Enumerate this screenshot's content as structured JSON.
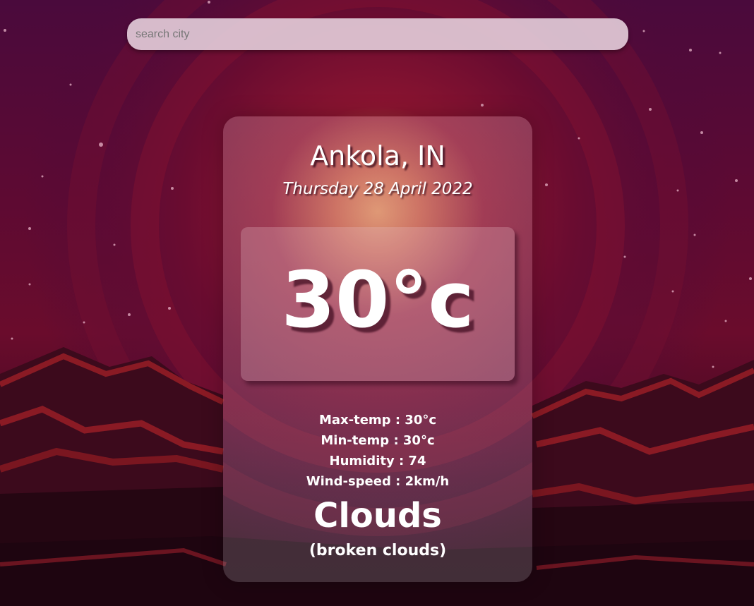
{
  "search": {
    "placeholder": "search city",
    "value": ""
  },
  "weather": {
    "location": "Ankola, IN",
    "date": "Thursday 28 April 2022",
    "temperature": "30°c",
    "stats": [
      {
        "label": "Max-temp : 30°c"
      },
      {
        "label": "Min-temp : 30°c"
      },
      {
        "label": "Humidity : 74"
      },
      {
        "label": "Wind-speed : 2km/h"
      }
    ],
    "condition": "Clouds",
    "description": "(broken clouds)"
  },
  "colors": {
    "sky_top": "#4a0a3c",
    "sun_glow": "#c8643c",
    "mountain_dark": "#2a0714",
    "ridge_red": "#8a1a24"
  }
}
